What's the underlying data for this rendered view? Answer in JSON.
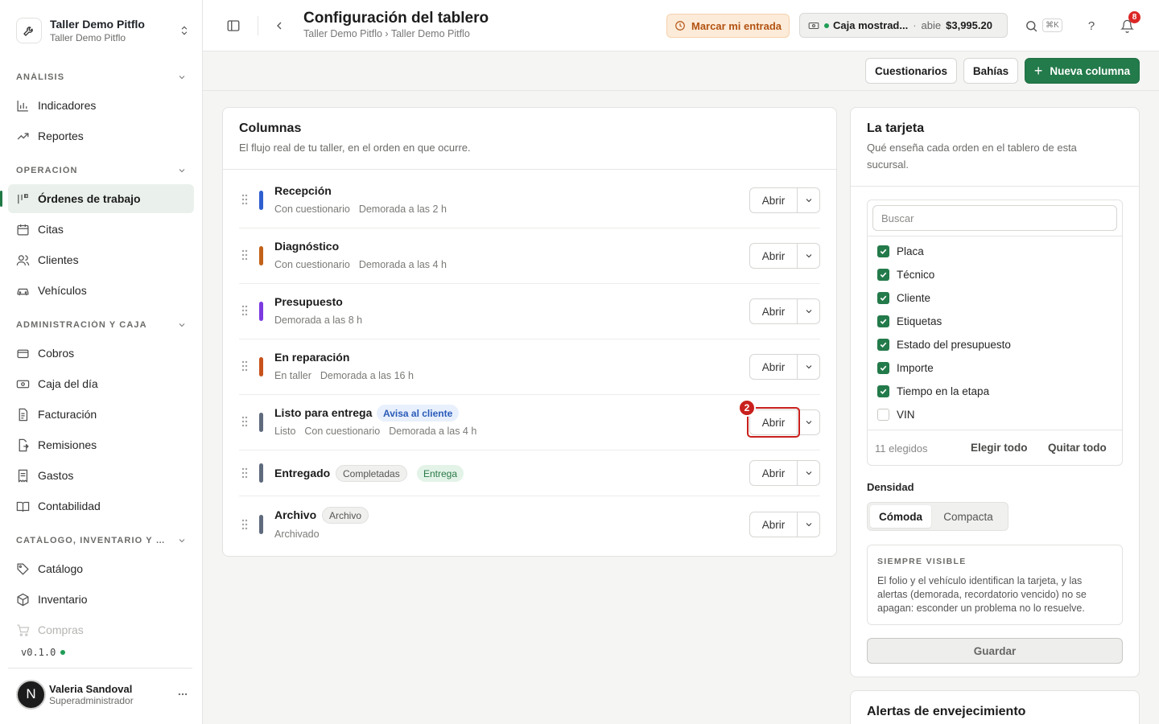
{
  "org": {
    "name": "Taller Demo Pitflo",
    "subtitle": "Taller Demo Pitflo"
  },
  "sidebar": {
    "sections": [
      {
        "title": "ANÁLISIS"
      },
      {
        "title": "OPERACIÓN"
      },
      {
        "title": "ADMINISTRACIÓN Y CAJA"
      },
      {
        "title": "CATÁLOGO, INVENTARIO Y COMPRAS"
      }
    ],
    "items": [
      {
        "label": "Indicadores",
        "icon": "bar-chart-icon"
      },
      {
        "label": "Reportes",
        "icon": "trending-up-icon"
      },
      {
        "label": "Órdenes de trabajo",
        "icon": "kanban-icon",
        "active": true
      },
      {
        "label": "Citas",
        "icon": "calendar-icon"
      },
      {
        "label": "Clientes",
        "icon": "users-icon"
      },
      {
        "label": "Vehículos",
        "icon": "car-icon"
      },
      {
        "label": "Cobros",
        "icon": "wallet-icon"
      },
      {
        "label": "Caja del día",
        "icon": "cash-icon"
      },
      {
        "label": "Facturación",
        "icon": "invoice-icon"
      },
      {
        "label": "Remisiones",
        "icon": "file-export-icon"
      },
      {
        "label": "Gastos",
        "icon": "receipt-icon"
      },
      {
        "label": "Contabilidad",
        "icon": "book-icon"
      },
      {
        "label": "Catálogo",
        "icon": "tag-icon"
      },
      {
        "label": "Inventario",
        "icon": "box-icon"
      },
      {
        "label": "Compras",
        "icon": "cart-icon"
      }
    ],
    "version": "v0.1.0"
  },
  "user": {
    "initial": "N",
    "name": "Valeria Sandoval",
    "role": "Superadministrador"
  },
  "header": {
    "title": "Configuración del tablero",
    "breadcrumb": "Taller Demo Pitflo › Taller Demo Pitflo",
    "clock_in_label": "Marcar mi entrada",
    "cash": {
      "name": "Caja mostrad...",
      "separator": "·",
      "state": "abie",
      "amount": "$3,995.20"
    },
    "search_shortcut": "⌘K",
    "help": "?",
    "notifications_count": "8"
  },
  "toolbar": {
    "questionnaires_label": "Cuestionarios",
    "bays_label": "Bahías",
    "new_column_label": "Nueva columna"
  },
  "columns_card": {
    "title": "Columnas",
    "subtitle": "El flujo real de tu taller, en el orden en que ocurre.",
    "open_label": "Abrir",
    "rows": [
      {
        "name": "Recepción",
        "color": "#2f5fd0",
        "meta": [
          "Con cuestionario",
          "Demorada a las 2 h"
        ]
      },
      {
        "name": "Diagnóstico",
        "color": "#c2621a",
        "meta": [
          "Con cuestionario",
          "Demorada a las 4 h"
        ]
      },
      {
        "name": "Presupuesto",
        "color": "#7c3ae0",
        "meta": [
          "Demorada a las 8 h"
        ]
      },
      {
        "name": "En reparación",
        "color": "#c8521c",
        "meta": [
          "En taller",
          "Demorada a las 16 h"
        ]
      },
      {
        "name": "Listo para entrega",
        "color": "#5f6b7d",
        "badge": "Avisa al cliente",
        "meta": [
          "Listo",
          "Con cuestionario",
          "Demorada a las 4 h"
        ]
      },
      {
        "name": "Entregado",
        "color": "#5f6b7d",
        "badges": [
          "Completadas",
          "Entrega"
        ],
        "meta": []
      },
      {
        "name": "Archivo",
        "color": "#5f6b7d",
        "badge": "Archivo",
        "meta": [
          "Archivado"
        ]
      }
    ],
    "step_marker": "2"
  },
  "card_panel": {
    "title": "La tarjeta",
    "subtitle": "Qué enseña cada orden en el tablero de esta sucursal.",
    "search_placeholder": "Buscar",
    "fields": [
      {
        "label": "Placa",
        "checked": true
      },
      {
        "label": "Técnico",
        "checked": true
      },
      {
        "label": "Cliente",
        "checked": true
      },
      {
        "label": "Etiquetas",
        "checked": true
      },
      {
        "label": "Estado del presupuesto",
        "checked": true
      },
      {
        "label": "Importe",
        "checked": true
      },
      {
        "label": "Tiempo en la etapa",
        "checked": true
      },
      {
        "label": "VIN",
        "checked": false
      }
    ],
    "selected_count": "11 elegidos",
    "select_all": "Elegir todo",
    "clear_all": "Quitar todo",
    "density_label": "Densidad",
    "density_options": [
      "Cómoda",
      "Compacta"
    ],
    "always_visible_title": "SIEMPRE VISIBLE",
    "always_visible_text": "El folio y el vehículo identifican la tarjeta, y las alertas (demorada, recordatorio vencido) no se apagan: esconder un problema no lo resuelve.",
    "save_label": "Guardar"
  },
  "aging_card": {
    "title": "Alertas de envejecimiento"
  },
  "colors": {
    "accent": "#237a4a",
    "warning": "#b25312",
    "danger": "#c9201d"
  }
}
